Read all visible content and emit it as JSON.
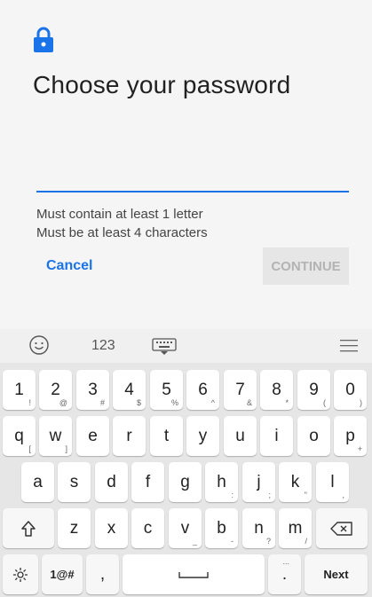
{
  "dialog": {
    "title": "Choose your password",
    "password_value": "",
    "requirements": [
      "Must contain at least 1 letter",
      "Must be at least 4 characters"
    ],
    "cancel_label": "Cancel",
    "continue_label": "CONTINUE",
    "accent_color": "#1a73e8"
  },
  "keyboard": {
    "toolbar": {
      "numbers_label": "123",
      "icons": [
        "emoji-icon",
        "keyboard-hide-icon",
        "menu-icon"
      ]
    },
    "row1": [
      {
        "main": "1",
        "sub": "!"
      },
      {
        "main": "2",
        "sub": "@"
      },
      {
        "main": "3",
        "sub": "#"
      },
      {
        "main": "4",
        "sub": "$"
      },
      {
        "main": "5",
        "sub": "%"
      },
      {
        "main": "6",
        "sub": "^"
      },
      {
        "main": "7",
        "sub": "&"
      },
      {
        "main": "8",
        "sub": "*"
      },
      {
        "main": "9",
        "sub": "("
      },
      {
        "main": "0",
        "sub": ")"
      }
    ],
    "row2": [
      {
        "main": "q",
        "sub": "["
      },
      {
        "main": "w",
        "sub": "]"
      },
      {
        "main": "e",
        "sub": ""
      },
      {
        "main": "r",
        "sub": ""
      },
      {
        "main": "t",
        "sub": ""
      },
      {
        "main": "y",
        "sub": ""
      },
      {
        "main": "u",
        "sub": ""
      },
      {
        "main": "i",
        "sub": ""
      },
      {
        "main": "o",
        "sub": ""
      },
      {
        "main": "p",
        "sub": "+"
      }
    ],
    "row3": [
      {
        "main": "a",
        "sub": ""
      },
      {
        "main": "s",
        "sub": ""
      },
      {
        "main": "d",
        "sub": ""
      },
      {
        "main": "f",
        "sub": ""
      },
      {
        "main": "g",
        "sub": ""
      },
      {
        "main": "h",
        "sub": ":"
      },
      {
        "main": "j",
        "sub": ";"
      },
      {
        "main": "k",
        "sub": "\""
      },
      {
        "main": "l",
        "sub": ","
      }
    ],
    "row4": [
      {
        "main": "z",
        "sub": ""
      },
      {
        "main": "x",
        "sub": ""
      },
      {
        "main": "c",
        "sub": ""
      },
      {
        "main": "v",
        "sub": "_"
      },
      {
        "main": "b",
        "sub": "-"
      },
      {
        "main": "n",
        "sub": "?"
      },
      {
        "main": "m",
        "sub": "/"
      }
    ],
    "symbols_label": "1@#",
    "comma_label": ",",
    "period_label": ".",
    "period_sub": "...",
    "next_label": "Next"
  }
}
